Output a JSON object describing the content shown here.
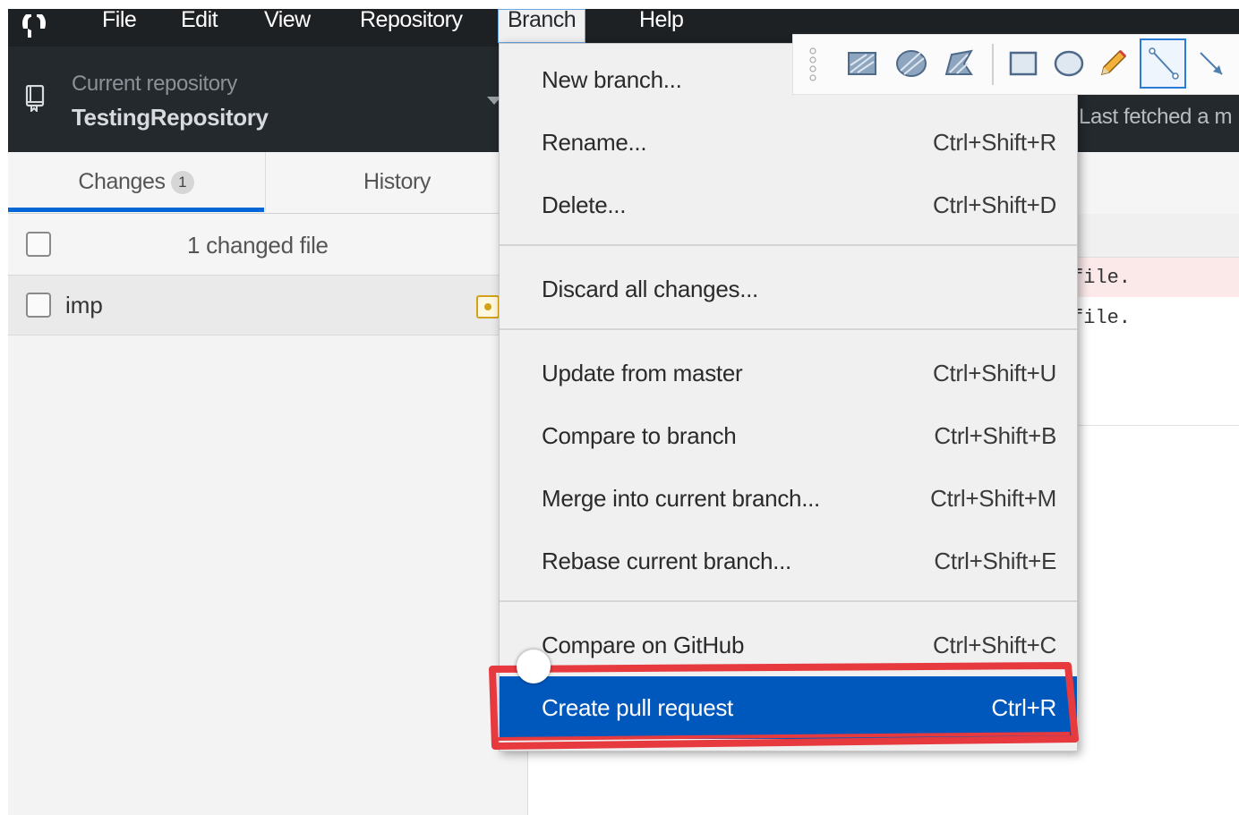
{
  "menubar": {
    "items": [
      "File",
      "Edit",
      "View",
      "Repository",
      "Branch",
      "Help"
    ],
    "open_item": "Branch"
  },
  "header": {
    "repo_label": "Current repository",
    "repo_name": "TestingRepository",
    "fetch_text": "Last fetched a m"
  },
  "tabs": {
    "changes_label": "Changes",
    "changes_count": "1",
    "history_label": "History"
  },
  "file_list": {
    "summary": "1 changed file",
    "files": [
      "imp"
    ]
  },
  "diff": {
    "deleted_line": "file.",
    "added_line": "file."
  },
  "branch_menu": {
    "items": [
      {
        "label": "New branch...",
        "shortcut": ""
      },
      {
        "label": "Rename...",
        "shortcut": "Ctrl+Shift+R"
      },
      {
        "label": "Delete...",
        "shortcut": "Ctrl+Shift+D"
      },
      {
        "label": "Discard all changes...",
        "shortcut": ""
      },
      {
        "label": "Update from master",
        "shortcut": "Ctrl+Shift+U"
      },
      {
        "label": "Compare to branch",
        "shortcut": "Ctrl+Shift+B"
      },
      {
        "label": "Merge into current branch...",
        "shortcut": "Ctrl+Shift+M"
      },
      {
        "label": "Rebase current branch...",
        "shortcut": "Ctrl+Shift+E"
      },
      {
        "label": "Compare on GitHub",
        "shortcut": "Ctrl+Shift+C"
      },
      {
        "label": "Create pull request",
        "shortcut": "Ctrl+R"
      }
    ],
    "highlighted": "Create pull request"
  },
  "annotation_toolbar": {
    "tools": [
      "hatched-rect-icon",
      "hatched-ellipse-icon",
      "hatched-polygon-icon",
      "rectangle-icon",
      "ellipse-icon",
      "pencil-icon",
      "line-icon",
      "arrow-icon"
    ],
    "selected_tool": "line-icon"
  },
  "colors": {
    "highlight": "#0058bd",
    "annotation_red": "#e63a3f",
    "header_bg": "#24292e"
  }
}
